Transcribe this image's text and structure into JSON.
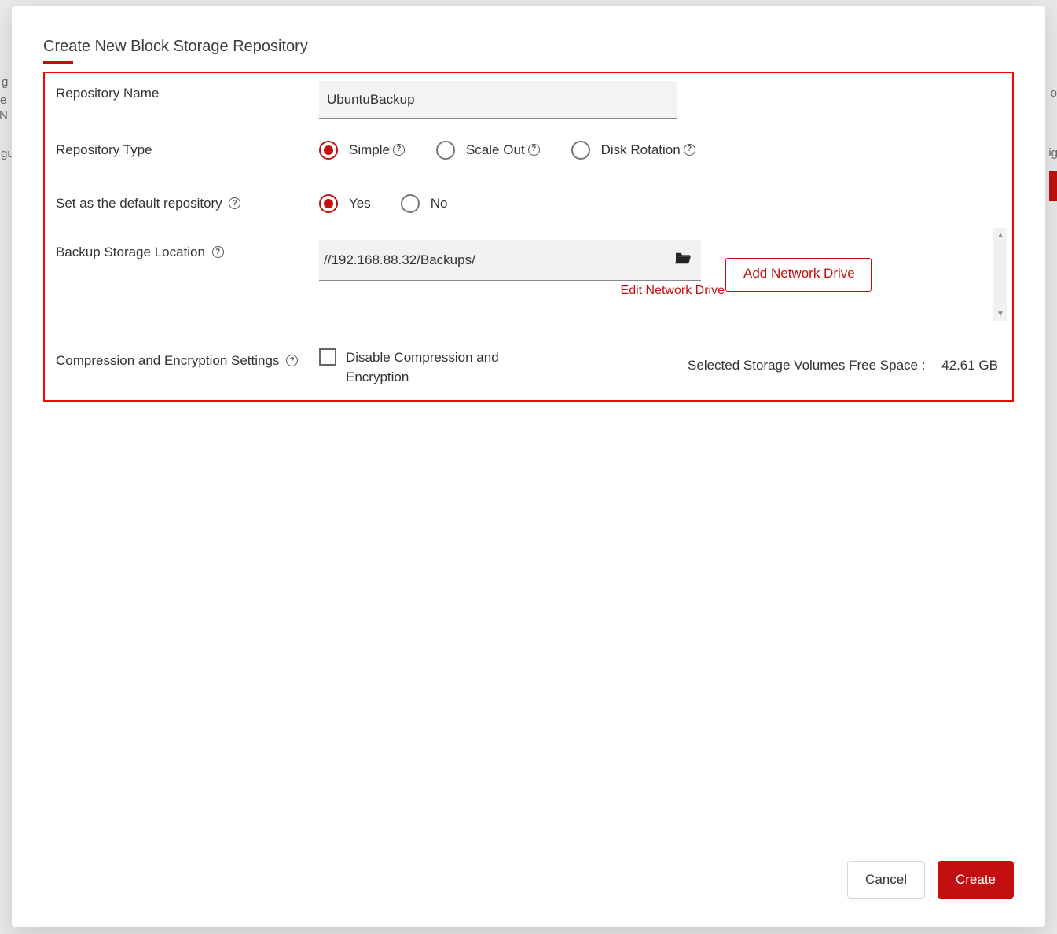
{
  "dialog": {
    "title": "Create New Block Storage Repository"
  },
  "form": {
    "repo_name": {
      "label": "Repository Name",
      "value": "UbuntuBackup"
    },
    "repo_type": {
      "label": "Repository Type",
      "options": {
        "simple": "Simple",
        "scaleout": "Scale Out",
        "diskrotation": "Disk Rotation"
      },
      "selected": "simple"
    },
    "default_repo": {
      "label": "Set as the default repository",
      "options": {
        "yes": "Yes",
        "no": "No"
      },
      "selected": "yes"
    },
    "storage_location": {
      "label": "Backup Storage Location",
      "value": "//192.168.88.32/Backups/",
      "edit_link": "Edit Network Drive",
      "add_button": "Add Network Drive"
    },
    "compression": {
      "label": "Compression and Encryption Settings",
      "checkbox_label": "Disable Compression and Encryption",
      "checked": false
    },
    "free_space": {
      "label": "Selected Storage Volumes Free Space :",
      "value": "42.61 GB"
    }
  },
  "footer": {
    "cancel": "Cancel",
    "create": "Create"
  }
}
